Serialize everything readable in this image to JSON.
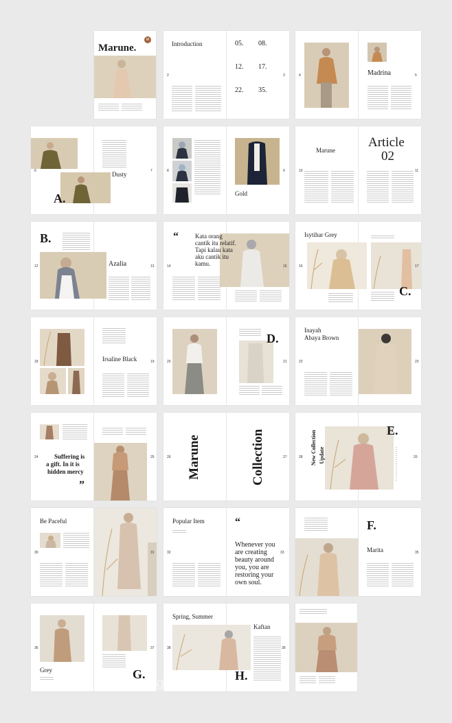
{
  "brand": {
    "title": "Marune.",
    "logo_letter": "M"
  },
  "colors": {
    "background": "#eaeaea",
    "page": "#ffffff",
    "accent": "#a0643c",
    "beige": "#d8cbb6"
  },
  "toc": {
    "heading": "Introduction",
    "numbers": [
      "05.",
      "08.",
      "12.",
      "17.",
      "22.",
      "35."
    ]
  },
  "headings": {
    "madrina": "Madrina",
    "dusty": "Dusty",
    "letter_a": "A.",
    "gold": "Gold",
    "marune": "Marune",
    "article": "Article",
    "article_num": "02",
    "letter_b": "B.",
    "azalia": "Azalia",
    "quote_open": "“",
    "quote_close": "”",
    "isytihar": "Isytihar Grey",
    "letter_c": "C.",
    "irsaline": "Irsaline Black",
    "letter_d": "D.",
    "inayah": "Inayah",
    "abaya": "Abaya Brown",
    "collection_a": "Marune",
    "collection_b": "Collection",
    "new_collection_1": "New Collection",
    "new_collection_2": "Update",
    "letter_e": "E.",
    "be_paceful": "Be Paceful",
    "popular": "Popular Item",
    "letter_f": "F.",
    "marita": "Marita",
    "grey": "Grey",
    "letter_g": "G.",
    "spring": "Spring, Summer",
    "kaftan": "Kaftan",
    "letter_h": "H."
  },
  "quotes": {
    "kata": [
      "Kata orang",
      "cantik itu relatif.",
      "Tapi kalau kata",
      "aku cantik itu",
      "kamu."
    ],
    "suffering": [
      "Suffering is",
      "a gift. In it is",
      "hidden mercy"
    ],
    "whenever": [
      "Whenever you",
      "are creating",
      "beauty around",
      "you, you are",
      "restoring your",
      "own soul."
    ]
  },
  "page_numbers": {
    "p2": "2",
    "p3": "3",
    "p4": "4",
    "p5": "5",
    "p6": "6",
    "p7": "7",
    "p8": "8",
    "p9": "9",
    "p10": "10",
    "p11": "11",
    "p12": "12",
    "p13": "13",
    "p14": "14",
    "p15": "15",
    "p16": "16",
    "p17": "17",
    "p18": "18",
    "p19": "19",
    "p20": "20",
    "p21": "21",
    "p22": "22",
    "p23": "23",
    "p24": "24",
    "p25": "25",
    "p26": "26",
    "p27": "27",
    "p28": "28",
    "p29": "20",
    "p30": "30",
    "p31": "31",
    "p32": "32",
    "p33": "33",
    "p34": "34",
    "p35": "35",
    "p36": "36",
    "p37": "37",
    "p38": "38",
    "p39": "39"
  },
  "watermark": "@huagongyuan.com"
}
